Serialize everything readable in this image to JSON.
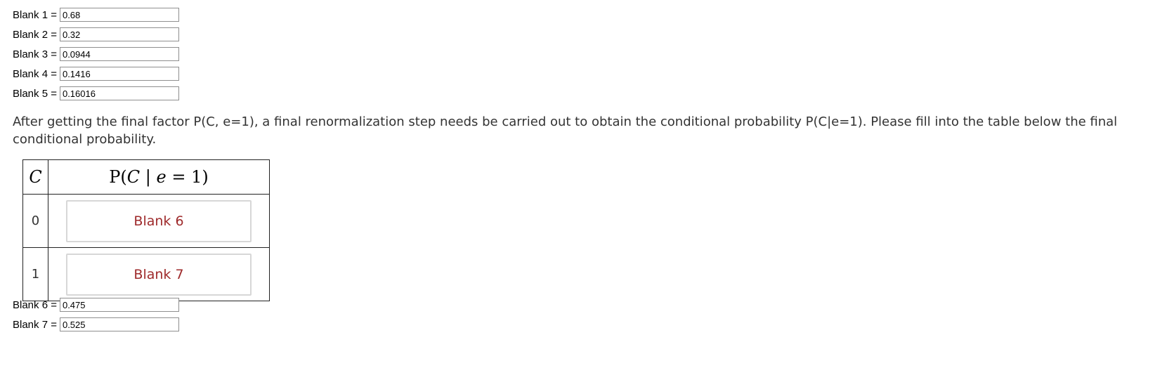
{
  "blanks_top": [
    {
      "label": "Blank 1 =",
      "value": "0.68"
    },
    {
      "label": "Blank 2 =",
      "value": "0.32"
    },
    {
      "label": "Blank 3 =",
      "value": "0.0944"
    },
    {
      "label": "Blank 4 =",
      "value": "0.1416"
    },
    {
      "label": "Blank 5 =",
      "value": "0.16016"
    }
  ],
  "paragraph": "After getting the final factor P(C, e=1),  a final renormalization step needs be carried out to obtain the conditional probability P(C|e=1). Please fill into the table below the final conditional probability.",
  "table": {
    "header_c": "C",
    "header_p_prefix": "P(",
    "header_p_var": "C",
    "header_p_mid": " | ",
    "header_p_e": "e",
    "header_p_suffix": " = 1)",
    "rows": [
      {
        "c": "0",
        "blank": "Blank 6"
      },
      {
        "c": "1",
        "blank": "Blank 7"
      }
    ]
  },
  "blanks_bottom": [
    {
      "label": "Blank 6 =",
      "value": "0.475"
    },
    {
      "label": "Blank 7 =",
      "value": "0.525"
    }
  ],
  "colors": {
    "blank_text": "#9e2a2b",
    "paragraph_text": "#333333"
  }
}
